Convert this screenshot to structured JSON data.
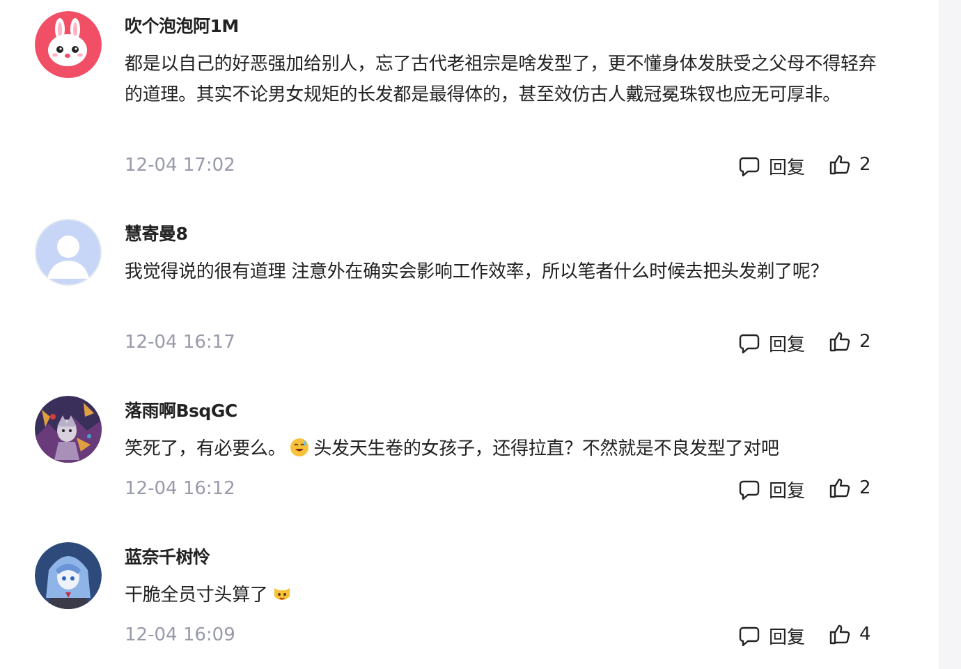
{
  "comments": [
    {
      "username": "吹个泡泡阿1M",
      "text": "都是以自己的好恶强加给别人，忘了古代老祖宗是啥发型了，更不懂身体发肤受之父母不得轻弃的道理。其实不论男女规矩的长发都是最得体的，甚至效仿古人戴冠冕珠钗也应无可厚非。",
      "time": "12-04 17:02",
      "reply_label": "回复",
      "likes": "2",
      "avatar": "pink-bunny-avatar"
    },
    {
      "username": "慧寄曼8",
      "text": "我觉得说的很有道理 注意外在确实会影响工作效率，所以笔者什么时候去把头发剃了呢？",
      "time": "12-04 16:17",
      "reply_label": "回复",
      "likes": "2",
      "avatar": "default-silhouette-avatar"
    },
    {
      "username": "落雨啊BsqGC",
      "text_before": "笑死了，有必要么。",
      "text_after": "头发天生卷的女孩子，还得拉直？不然就是不良发型了对吧",
      "emoji": "sweat-smile-emoji",
      "time": "12-04 16:12",
      "reply_label": "回复",
      "likes": "2",
      "avatar": "anime-dark-avatar"
    },
    {
      "username": "蓝奈千树怜",
      "text_before": "干脆全员寸头算了",
      "emoji": "cat-face-emoji",
      "time": "12-04 16:09",
      "reply_label": "回复",
      "likes": "4",
      "avatar": "anime-blue-hair-avatar"
    }
  ],
  "colors": {
    "text": "#222222",
    "timestamp": "#999aaa",
    "background": "#ffffff"
  }
}
